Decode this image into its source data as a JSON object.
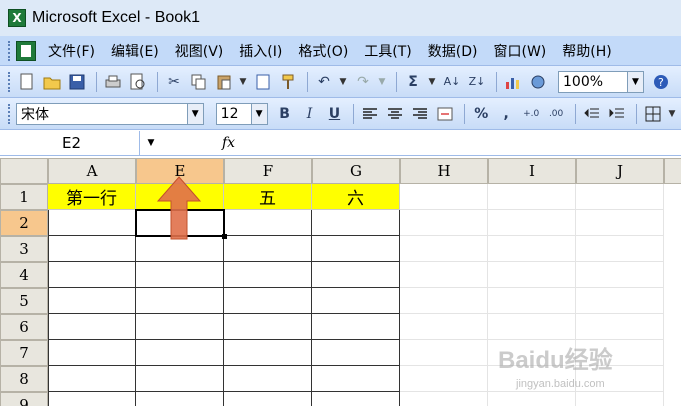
{
  "window": {
    "title": "Microsoft Excel - Book1",
    "app_icon": "X"
  },
  "menu": {
    "items": [
      "文件(F)",
      "编辑(E)",
      "视图(V)",
      "插入(I)",
      "格式(O)",
      "工具(T)",
      "数据(D)",
      "窗口(W)",
      "帮助(H)"
    ]
  },
  "toolbar_standard": {
    "icons": [
      "new-icon",
      "open-icon",
      "save-icon",
      "print-icon",
      "print-preview-icon",
      "cut-icon",
      "copy-icon",
      "paste-icon",
      "format-painter-icon",
      "undo-icon",
      "redo-icon",
      "autosum-icon",
      "sort-asc-icon",
      "sort-desc-icon",
      "chart-icon",
      "drawing-icon"
    ],
    "zoom": "100%"
  },
  "toolbar_formatting": {
    "font": "宋体",
    "size": "12",
    "bold": "B",
    "italic": "I",
    "underline": "U",
    "percent": "%",
    "comma": ","
  },
  "formula_bar": {
    "name_box": "E2",
    "fx": "fx"
  },
  "sheet": {
    "columns": [
      "A",
      "E",
      "F",
      "G",
      "H",
      "I",
      "J"
    ],
    "active_column": "E",
    "rows": [
      "1",
      "2",
      "3",
      "4",
      "5",
      "6",
      "7",
      "8",
      "9"
    ],
    "active_row": "2",
    "row1": [
      "第一行",
      "",
      "五",
      "六",
      "",
      "",
      ""
    ]
  },
  "annotation": {
    "arrow_color": "#e0704a"
  },
  "watermark": {
    "text": "Baidu经验",
    "url": "jingyan.baidu.com"
  }
}
